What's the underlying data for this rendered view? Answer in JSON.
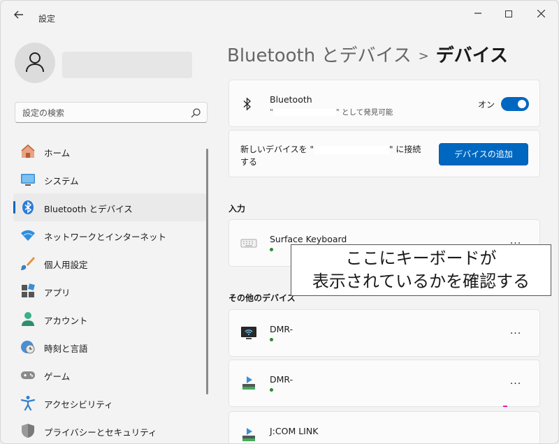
{
  "window": {
    "title": "設定",
    "back_icon": "arrow-left-icon"
  },
  "sidebar": {
    "search_placeholder": "設定の検索",
    "items": [
      {
        "label": "ホーム",
        "icon": "home-icon"
      },
      {
        "label": "システム",
        "icon": "monitor-icon"
      },
      {
        "label": "Bluetooth とデバイス",
        "icon": "bluetooth-icon",
        "active": true
      },
      {
        "label": "ネットワークとインターネット",
        "icon": "wifi-icon"
      },
      {
        "label": "個人用設定",
        "icon": "brush-icon"
      },
      {
        "label": "アプリ",
        "icon": "apps-icon"
      },
      {
        "label": "アカウント",
        "icon": "person-icon"
      },
      {
        "label": "時刻と言語",
        "icon": "clock-globe-icon"
      },
      {
        "label": "ゲーム",
        "icon": "gamepad-icon"
      },
      {
        "label": "アクセシビリティ",
        "icon": "accessibility-icon"
      },
      {
        "label": "プライバシーとセキュリティ",
        "icon": "shield-icon"
      }
    ]
  },
  "breadcrumb": {
    "parent": "Bluetooth とデバイス",
    "separator": ">",
    "current": "デバイス"
  },
  "bluetooth": {
    "title": "Bluetooth",
    "subtitle_open_quote": "\"",
    "subtitle_rest": "\" として発見可能",
    "state": "オン"
  },
  "add_device": {
    "text_before": "新しいデバイスを \"",
    "text_after": "\" に接続する",
    "button_label": "デバイスの追加"
  },
  "sections": {
    "input": "入力",
    "other": "その他のデバイス"
  },
  "devices": {
    "keyboard": {
      "name": "Surface Keyboard",
      "more": "..."
    },
    "dmr1": {
      "name": "DMR-",
      "more": "..."
    },
    "dmr2": {
      "name": "DMR-",
      "more": "..."
    },
    "jcom": {
      "name": "J:COM LINK"
    }
  },
  "callout": {
    "line1": "ここにキーボードが",
    "line2": "表示されているかを確認する"
  },
  "colors": {
    "accent": "#0067c0",
    "status_green": "#2e8b2e"
  }
}
